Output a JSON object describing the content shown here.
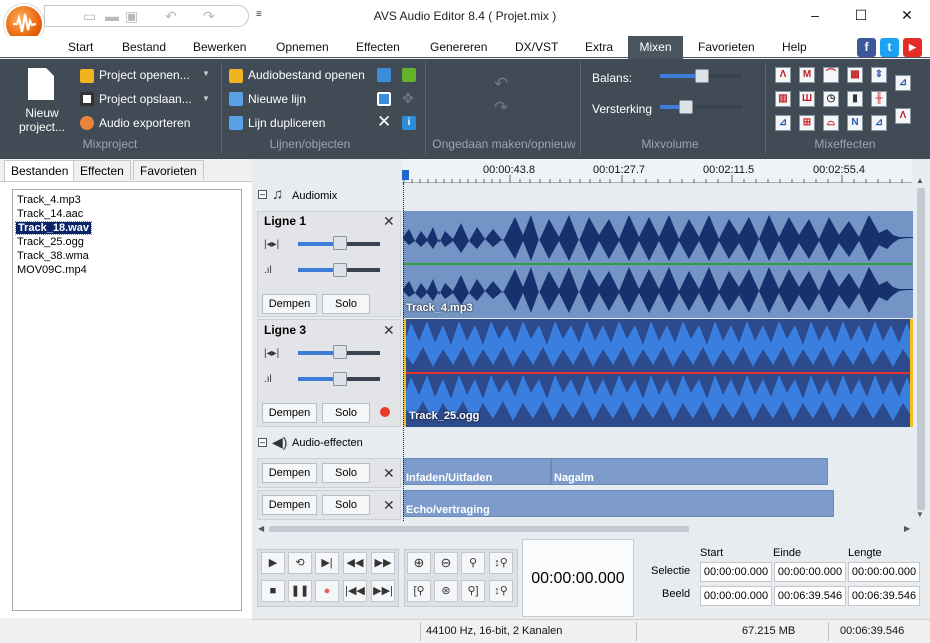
{
  "window": {
    "title": "AVS Audio Editor 8.4  ( Projet.mix )",
    "minimize": "–",
    "maximize": "☐",
    "close": "✕"
  },
  "menu_tabs": [
    "Start",
    "Bestand",
    "Bewerken",
    "Opnemen",
    "Effecten",
    "Genereren",
    "DX/VST",
    "Extra",
    "Mixen",
    "Favorieten",
    "Help"
  ],
  "active_tab": "Mixen",
  "social": {
    "facebook": "f",
    "twitter": "t",
    "youtube": "▶"
  },
  "ribbon": {
    "new_project": "Nieuw project...",
    "open_project": "Project openen...",
    "save_project": "Project opslaan...",
    "export_audio": "Audio exporteren",
    "group_mixproject": "Mixproject",
    "open_audiofile": "Audiobestand openen",
    "new_line": "Nieuwe lijn",
    "duplicate_line": "Lijn dupliceren",
    "group_lines": "Lijnen/objecten",
    "group_undo": "Ongedaan maken/opnieuw",
    "balance": "Balans:",
    "gain": "Versterking",
    "group_mixvolume": "Mixvolume",
    "group_mixeffects": "Mixeffecten"
  },
  "panel": {
    "tabs": [
      "Bestanden",
      "Effecten",
      "Favorieten"
    ],
    "files": [
      "Track_4.mp3",
      "Track_14.aac",
      "Track_18.wav",
      "Track_25.ogg",
      "Track_38.wma",
      "MOV09C.mp4"
    ],
    "selected_file": "Track_18.wav"
  },
  "timeline": {
    "marks": [
      "00:00:43.8",
      "00:01:27.7",
      "00:02:11.5",
      "00:02:55.4"
    ]
  },
  "mix": {
    "audiomix_label": "Audiomix",
    "tracks": [
      {
        "name": "Ligne 1",
        "clip": "Track_4.mp3",
        "mute": "Dempen",
        "solo": "Solo"
      },
      {
        "name": "Ligne 3",
        "clip": "Track_25.ogg",
        "mute": "Dempen",
        "solo": "Solo"
      }
    ],
    "effects_label": "Audio-effecten",
    "effect_rows": [
      {
        "mute": "Dempen",
        "solo": "Solo",
        "effects": [
          "Infaden/Uitfaden",
          "Nagalm"
        ]
      },
      {
        "mute": "Dempen",
        "solo": "Solo",
        "effects": [
          "Echo/vertraging"
        ]
      }
    ]
  },
  "transport": {
    "time": "00:00:00.000",
    "headers": [
      "Start",
      "Einde",
      "Lengte"
    ],
    "selectie_label": "Selectie",
    "beeld_label": "Beeld",
    "selectie": [
      "00:00:00.000",
      "00:00:00.000",
      "00:00:00.000"
    ],
    "beeld": [
      "00:00:00.000",
      "00:06:39.546",
      "00:06:39.546"
    ]
  },
  "status": {
    "format": "44100 Hz, 16-bit, 2 Kanalen",
    "size": "67.215 MB",
    "duration": "00:06:39.546"
  },
  "colors": {
    "ribbon": "#414b55",
    "wave_light": "#7394c4",
    "wave_dark": "#2d4a8c",
    "accent": "#3d7dd8",
    "effect_bar": "#7d9ccc"
  }
}
